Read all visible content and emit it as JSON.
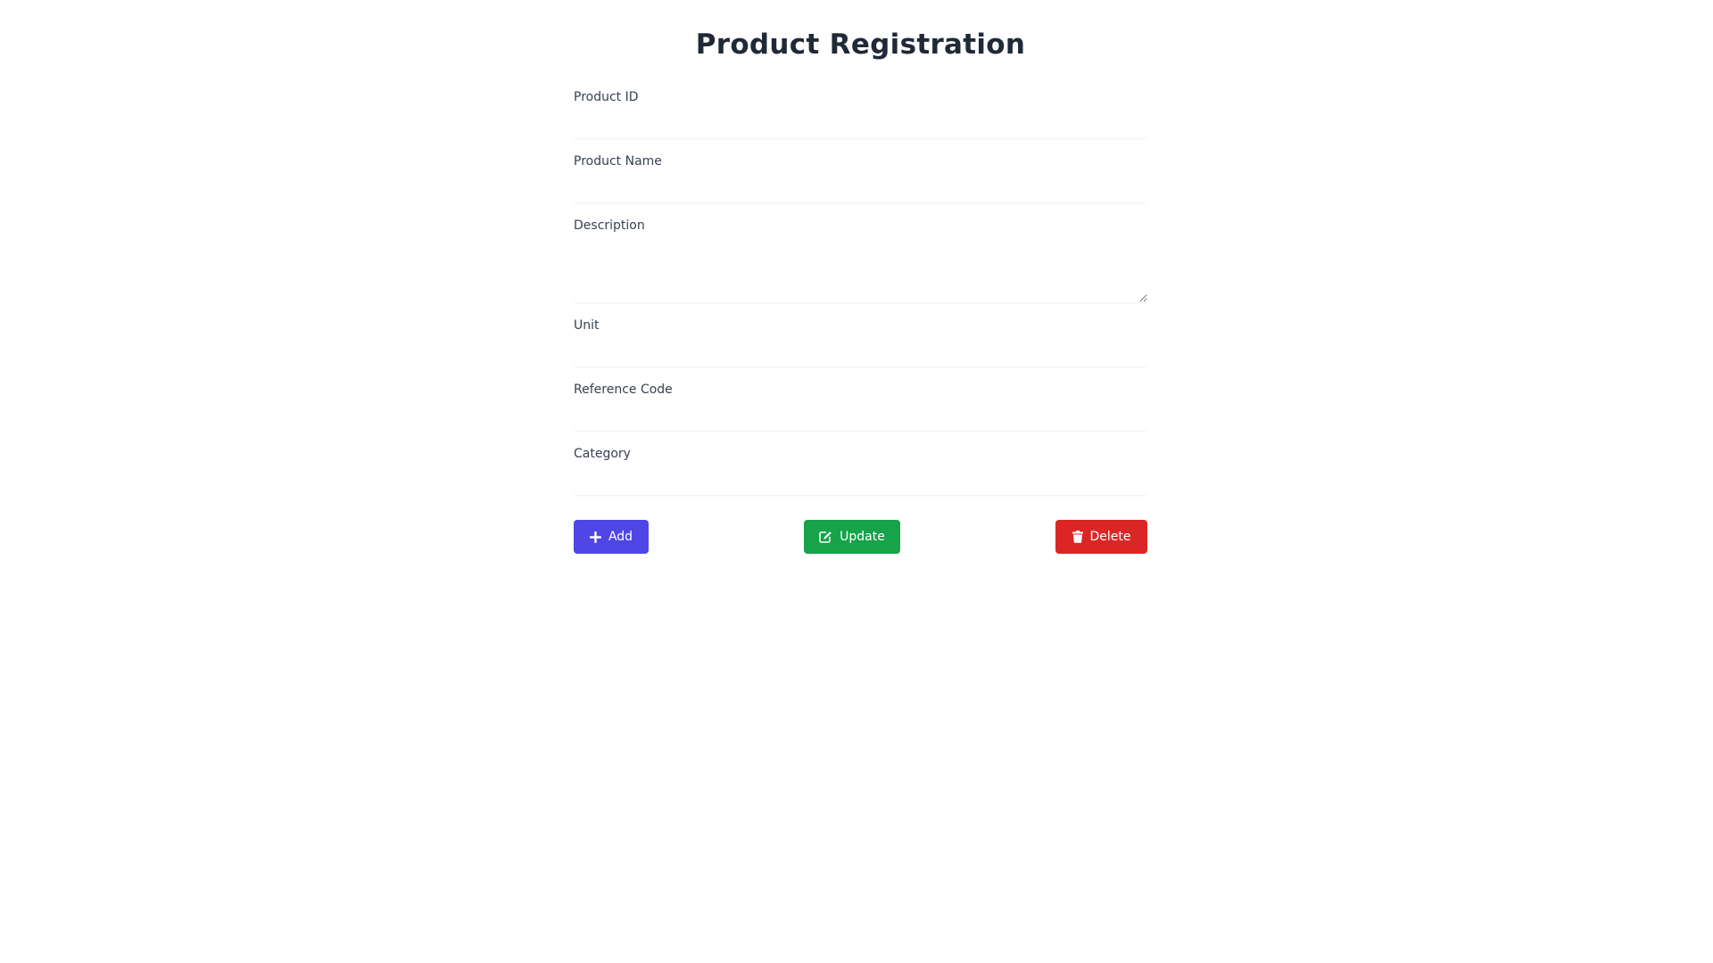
{
  "form": {
    "title": "Product Registration",
    "fields": [
      {
        "label": "Product ID",
        "value": ""
      },
      {
        "label": "Product Name",
        "value": ""
      },
      {
        "label": "Description",
        "value": ""
      },
      {
        "label": "Unit",
        "value": ""
      },
      {
        "label": "Reference Code",
        "value": ""
      },
      {
        "label": "Category",
        "value": ""
      }
    ]
  },
  "buttons": {
    "add": {
      "label": "Add",
      "icon": "plus-icon",
      "color": "#4f46e5"
    },
    "update": {
      "label": "Update",
      "icon": "edit-icon",
      "color": "#16a34a"
    },
    "delete": {
      "label": "Delete",
      "icon": "trash-icon",
      "color": "#dc2626"
    }
  }
}
